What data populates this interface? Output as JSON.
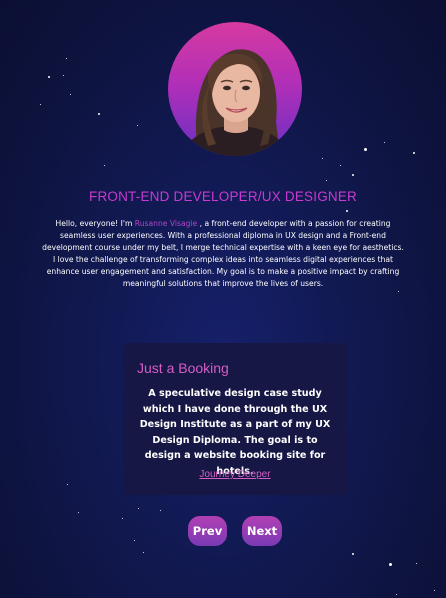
{
  "profile": {
    "role_title": "FRONT-END DEVELOPER/UX DESIGNER",
    "bio_intro": "Hello, everyone! I'm ",
    "name": "Rusanne Visagie",
    "bio_rest": " , a front-end developer with a passion for creating seamless user experiences. With a professional diploma in UX design and a Front-end development course under my belt, I merge technical expertise with a keen eye for aesthetics. I love the challenge of transforming complex ideas into seamless digital experiences that enhance user engagement and satisfaction. My goal is to make a positive impact by crafting meaningful solutions that improve the lives of users."
  },
  "project": {
    "title": "Just a Booking",
    "description": "A speculative design case study which I have done through the UX Design Institute as a part of my UX Design Diploma. The goal is to design a website booking site for hotels.",
    "link_label": "Journey Deeper"
  },
  "nav": {
    "prev_label": "Prev",
    "next_label": "Next"
  },
  "colors": {
    "background": "#121a55",
    "accent_title": "#c93ad0",
    "name_highlight": "#b146c9",
    "card_background": "#161744",
    "card_title": "#d65cc7",
    "button_gradient_top": "#b23fb4",
    "button_gradient_bottom": "#7a3ab4"
  },
  "icons": {
    "decoration": "star-icon"
  }
}
